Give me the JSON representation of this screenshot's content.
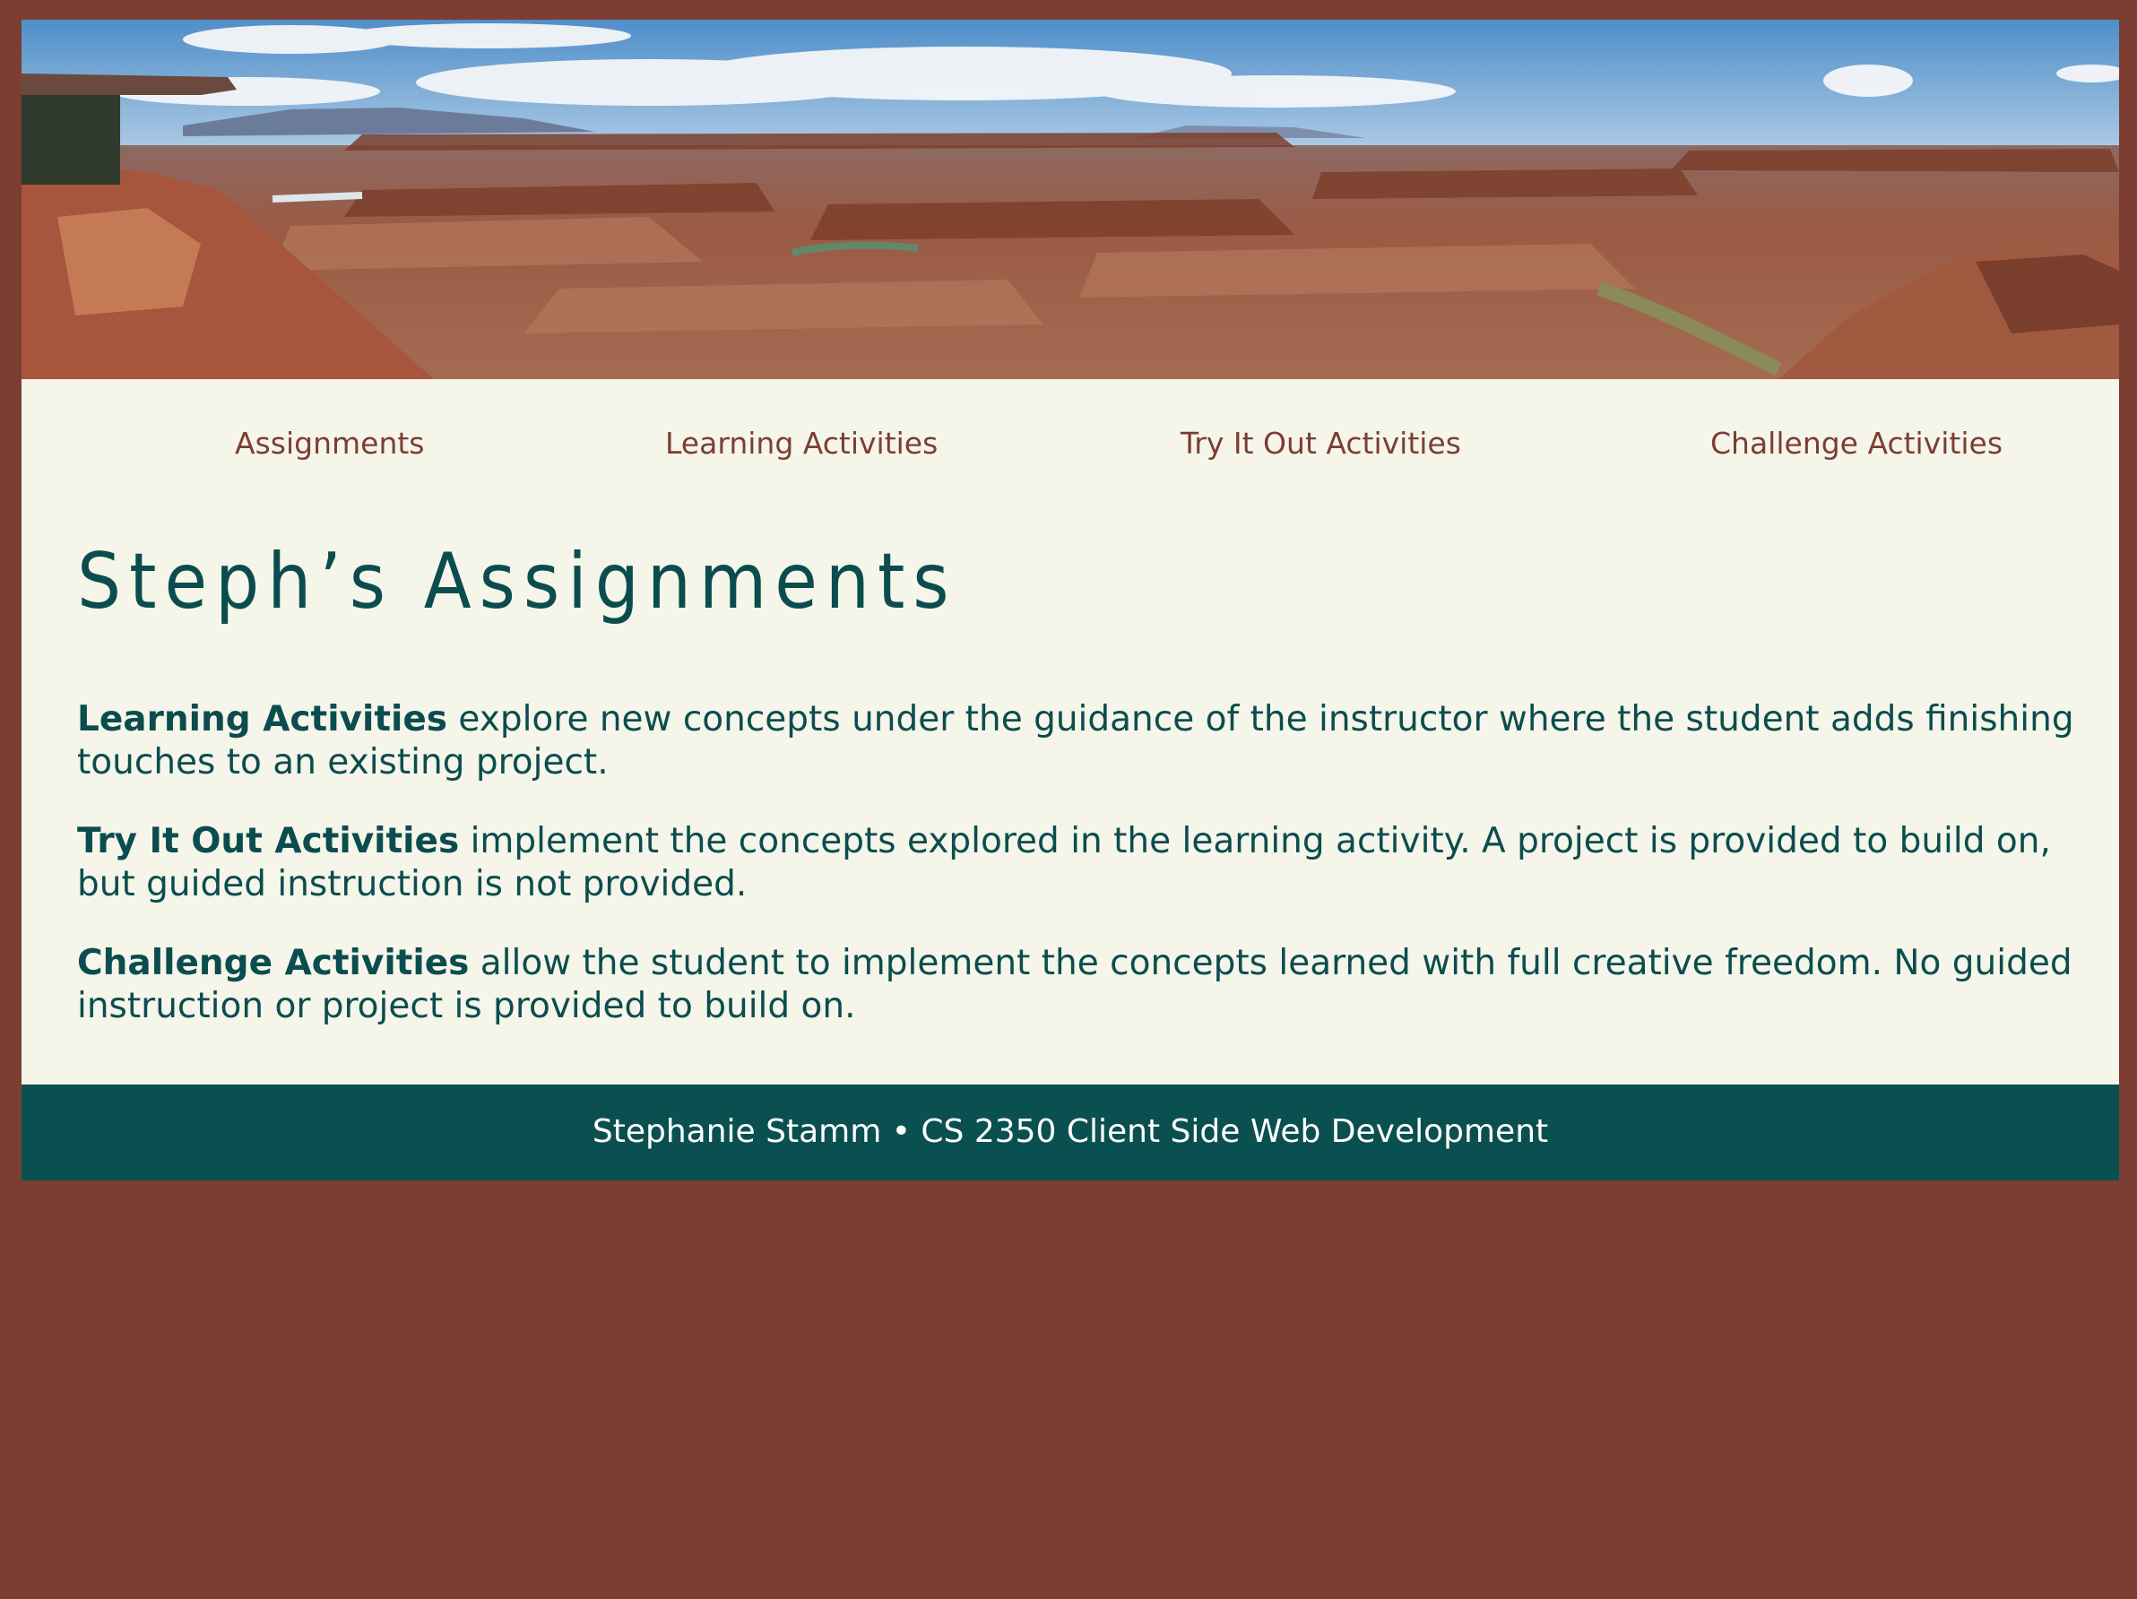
{
  "banner": {
    "alt": "Canyon panorama"
  },
  "nav": {
    "items": [
      {
        "label": "Assignments"
      },
      {
        "label": "Learning Activities"
      },
      {
        "label": "Try It Out Activities"
      },
      {
        "label": "Challenge Activities"
      }
    ]
  },
  "main": {
    "title": "Steph’s Assignments",
    "descriptions": [
      {
        "term": "Learning Activities",
        "text": " explore new concepts under the guidance of the instructor where the student adds finishing touches to an existing project."
      },
      {
        "term": "Try It Out Activities",
        "text": " implement the concepts explored in the learning activity. A project is provided to build on, but guided instruction is not provided."
      },
      {
        "term": "Challenge Activities",
        "text": " allow the student to implement the concepts learned with full creative freedom. No guided instruction or project is provided to build on."
      }
    ]
  },
  "footer": {
    "text": "Stephanie Stamm • CS 2350 Client Side Web Development"
  },
  "colors": {
    "page_background": "#7c3e33",
    "content_background": "#f5f5e9",
    "nav_link": "#7c3e33",
    "text_teal": "#0b4d4f",
    "footer_background": "#0b5050"
  }
}
